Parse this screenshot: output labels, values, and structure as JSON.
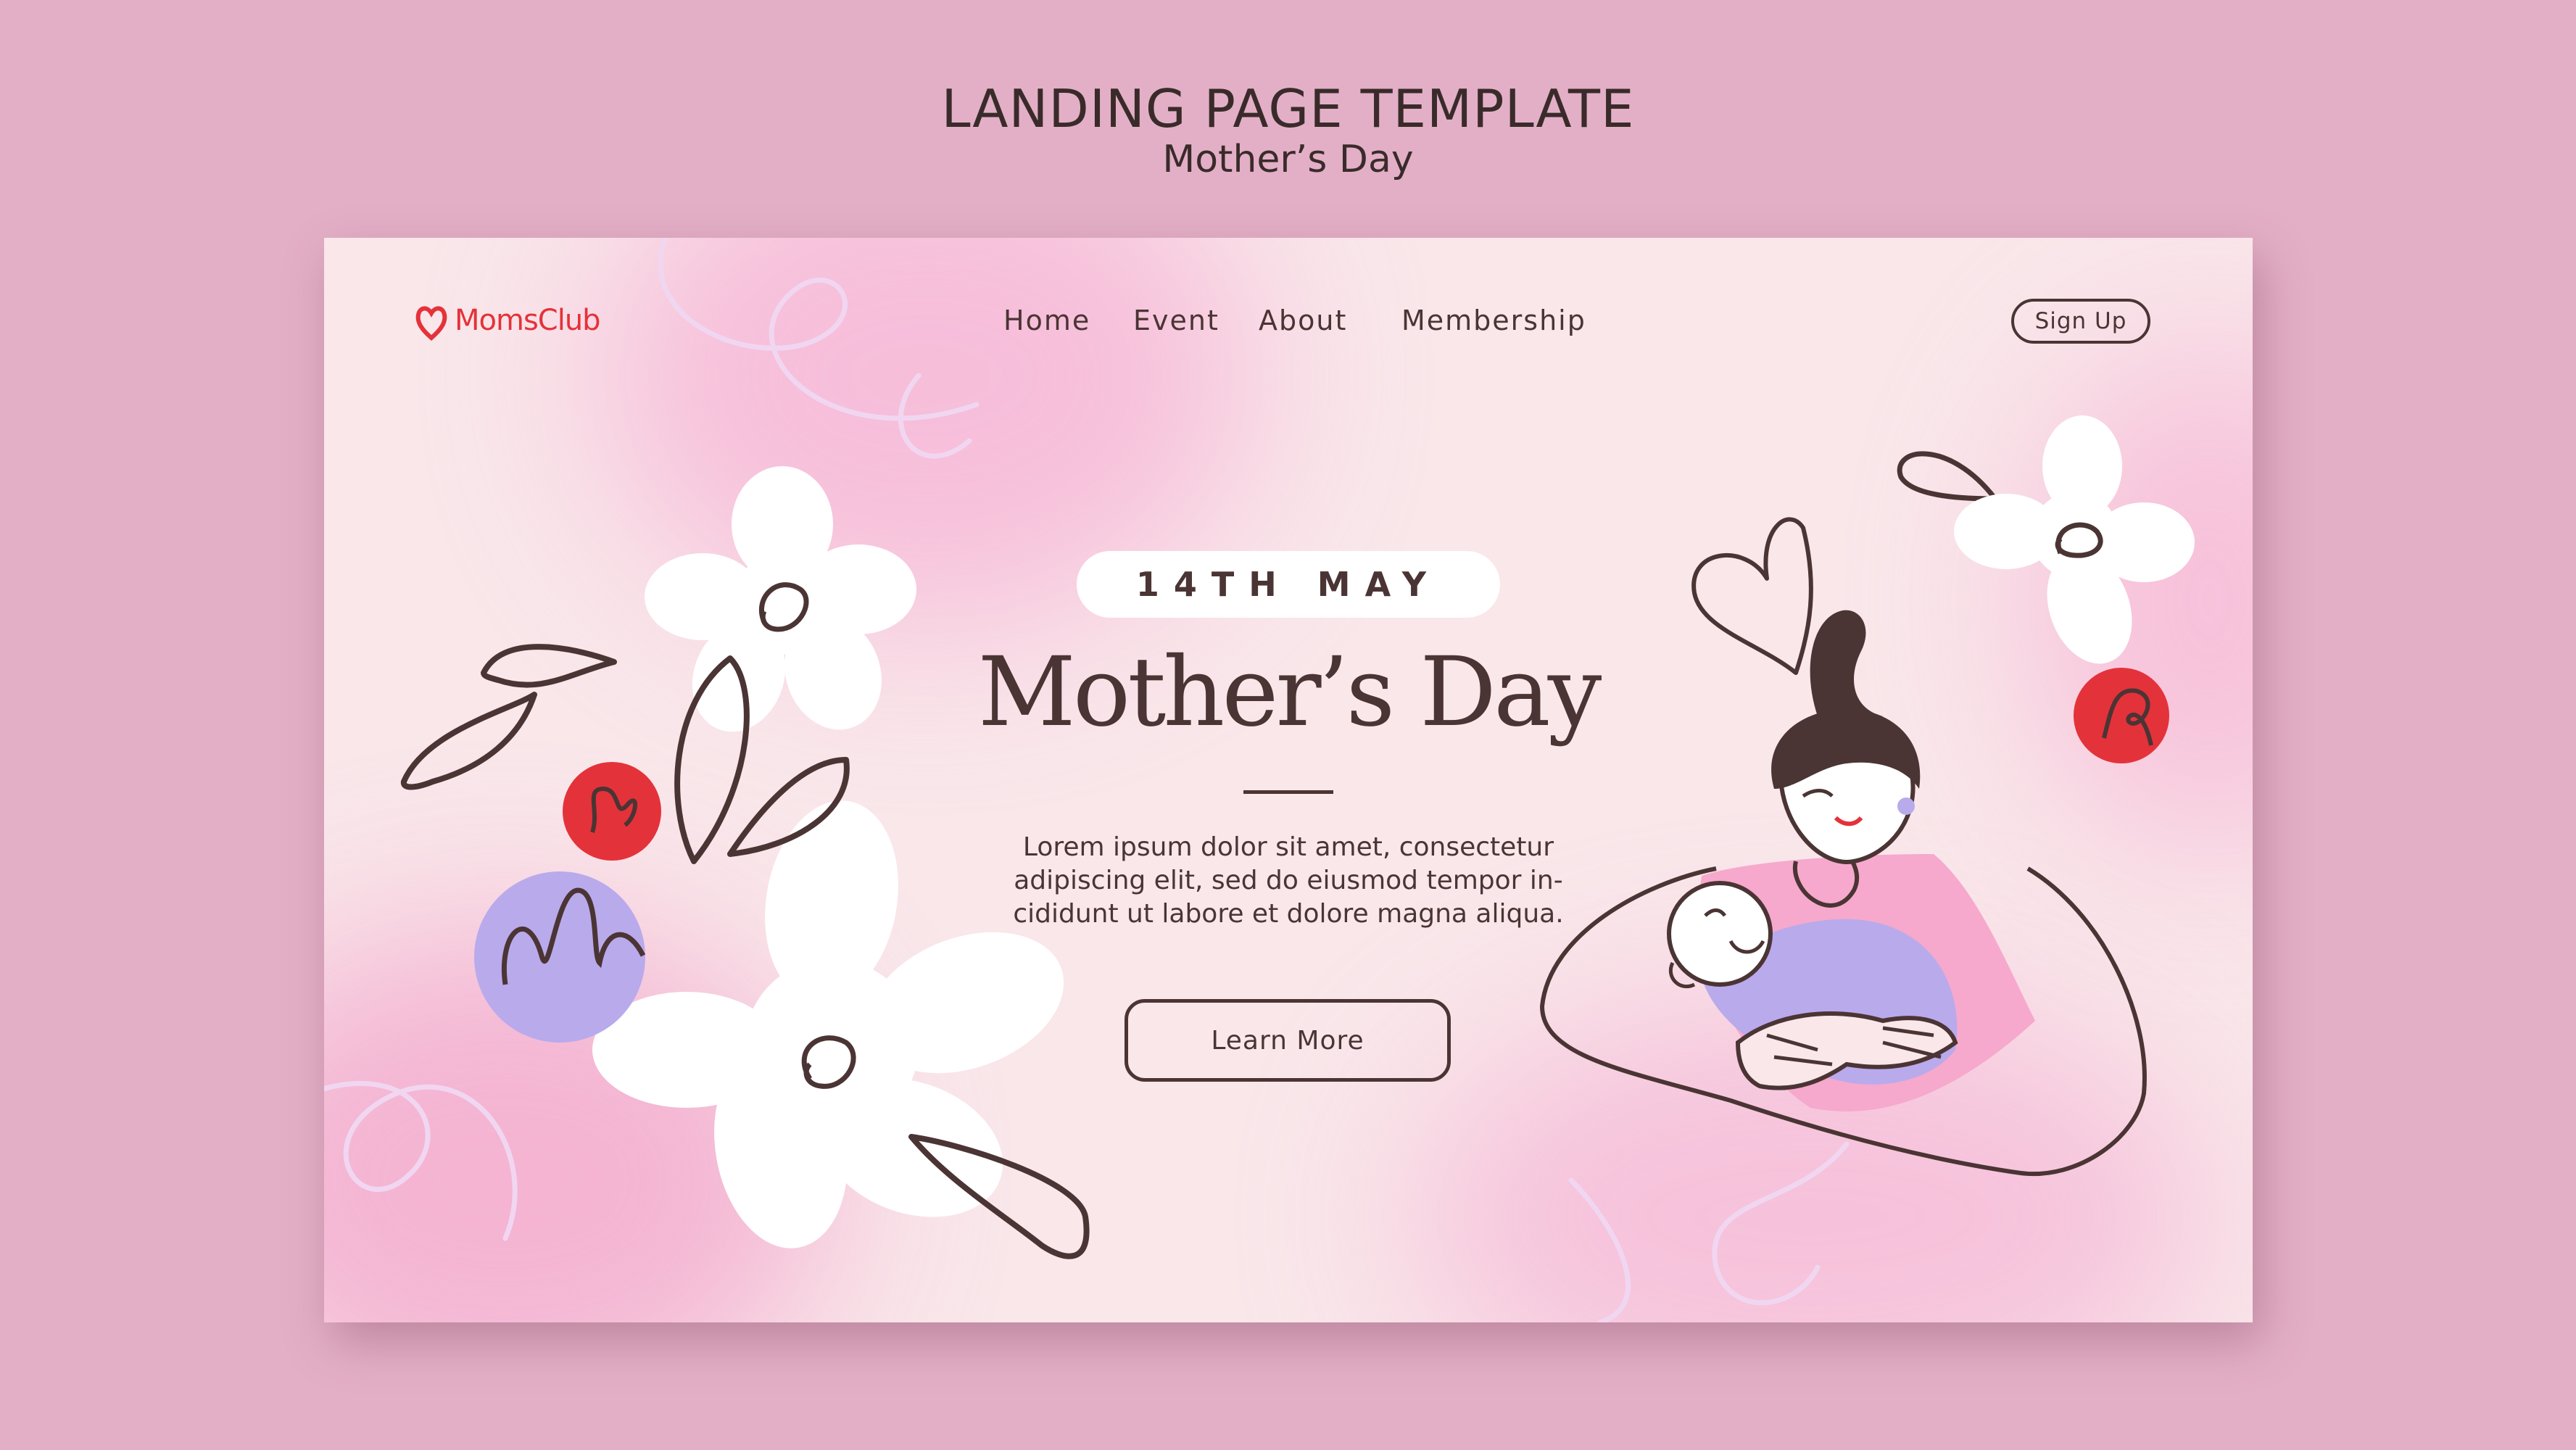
{
  "header": {
    "title": "LANDING PAGE TEMPLATE",
    "subtitle": "Mother’s Day"
  },
  "site": {
    "logo_text": "MomsClub",
    "logo_icon": "heart-icon",
    "nav": [
      "Home",
      "Event",
      "About",
      "Membership"
    ],
    "signup_label": "Sign Up"
  },
  "hero": {
    "date": "14TH MAY",
    "title": "Mother’s Day",
    "body_lines": [
      "Lorem ipsum dolor sit amet, consectetur",
      "adipiscing elit, sed do eiusmod tempor in-",
      "cididunt ut labore et dolore magna aliqua."
    ],
    "cta_label": "Learn More"
  },
  "illustrations": [
    "flower-icon",
    "petal-doodle-icon",
    "heart-doodle-icon",
    "mother-baby-illustration"
  ],
  "colors": {
    "background": "#e3afc6",
    "page": "#f9e7ea",
    "accent_red": "#e4323a",
    "lavender": "#b9aaec",
    "pink": "#f6a9cc",
    "text": "#4b3434"
  }
}
